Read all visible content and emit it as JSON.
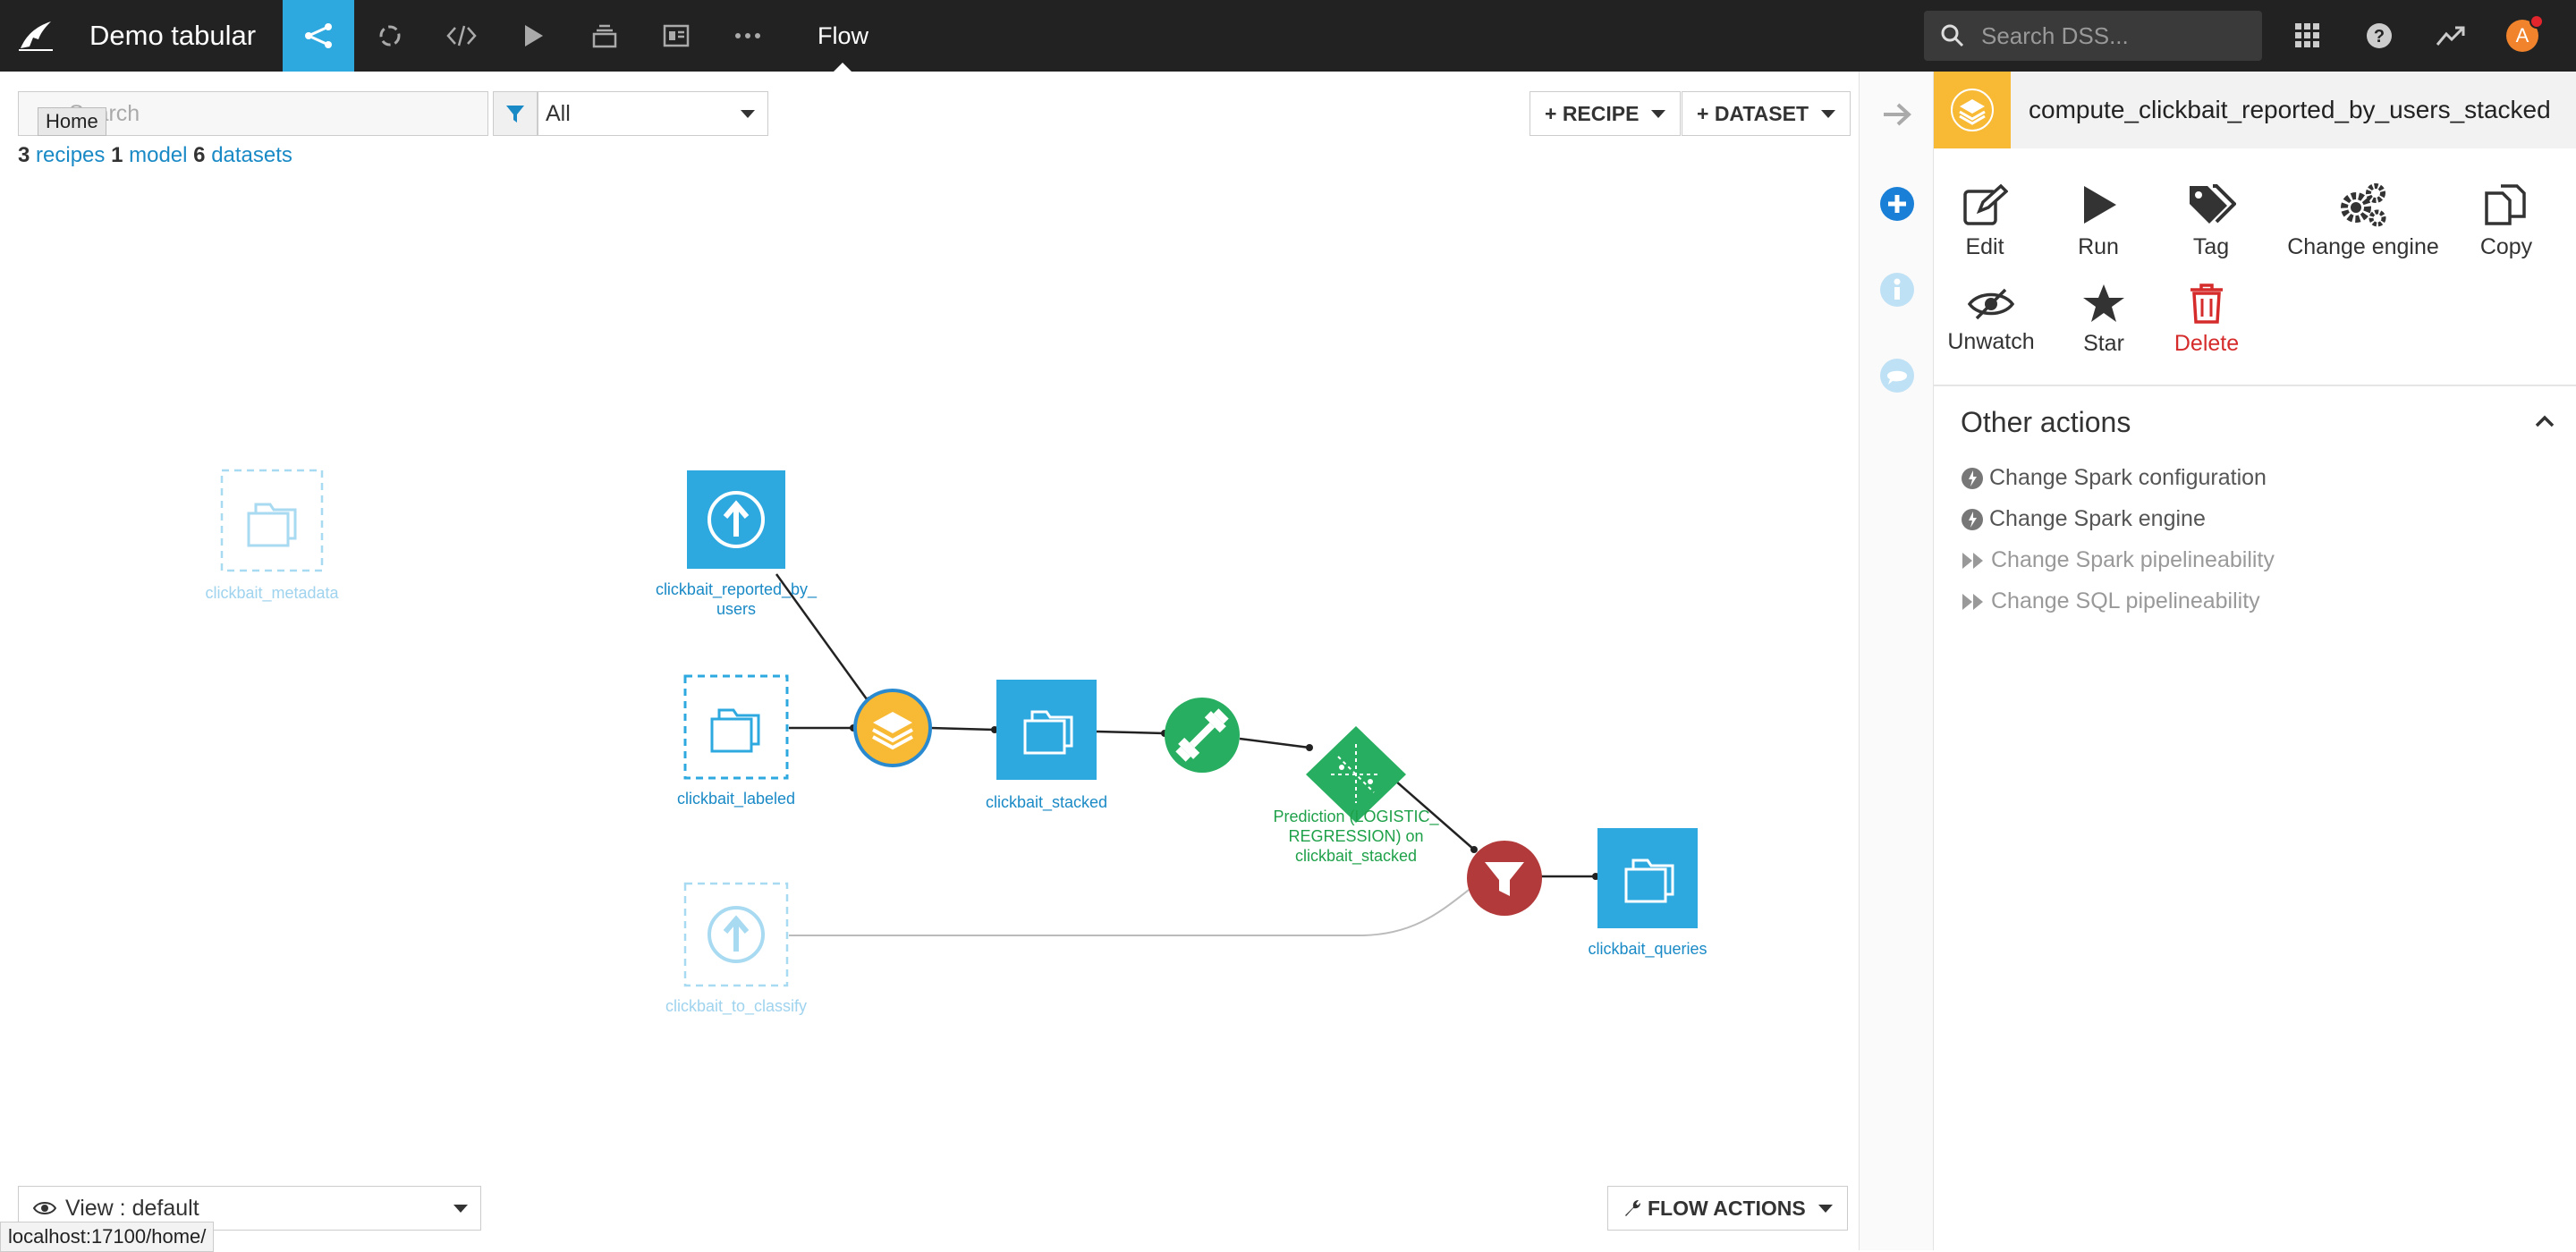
{
  "topbar": {
    "project_title": "Demo tabular",
    "current_section": "Flow",
    "search_placeholder": "Search DSS...",
    "avatar_initial": "A"
  },
  "flow": {
    "search_placeholder": "Search",
    "home_tooltip": "Home",
    "filter_value": "All",
    "counts": {
      "recipes_count": "3",
      "recipes_label": "recipes",
      "models_count": "1",
      "models_label": "model",
      "datasets_count": "6",
      "datasets_label": "datasets"
    },
    "add_recipe_label": "+ RECIPE",
    "add_dataset_label": "+ DATASET",
    "view_label": "View : default",
    "flow_actions_label": "FLOW ACTIONS",
    "status_url": "localhost:17100/home/",
    "nodes": {
      "clickbait_metadata": "clickbait_metadata",
      "clickbait_reported_line1": "clickbait_reported_by_",
      "clickbait_reported_line2": "users",
      "clickbait_labeled": "clickbait_labeled",
      "clickbait_stacked": "clickbait_stacked",
      "clickbait_to_classify": "clickbait_to_classify",
      "clickbait_queries": "clickbait_queries",
      "model_line1": "Prediction (LOGISTIC_",
      "model_line2": "REGRESSION) on",
      "model_line3": "clickbait_stacked"
    }
  },
  "panel": {
    "title": "compute_clickbait_reported_by_users_stacked",
    "actions": {
      "edit": "Edit",
      "run": "Run",
      "tag": "Tag",
      "change_engine": "Change engine",
      "copy": "Copy",
      "unwatch": "Unwatch",
      "star": "Star",
      "delete": "Delete"
    },
    "other_actions_title": "Other actions",
    "other_actions": {
      "spark_config": "Change Spark configuration",
      "spark_engine": "Change Spark engine",
      "spark_pipelineability": "Change Spark pipelineability",
      "sql_pipelineability": "Change SQL pipelineability"
    }
  },
  "colors": {
    "topbar": "#222222",
    "accent_blue": "#2ea9e0",
    "recipe_yellow": "#f8b935",
    "model_green": "#27ae60",
    "filter_red": "#b33a3a",
    "delete_red": "#d52b2b"
  }
}
